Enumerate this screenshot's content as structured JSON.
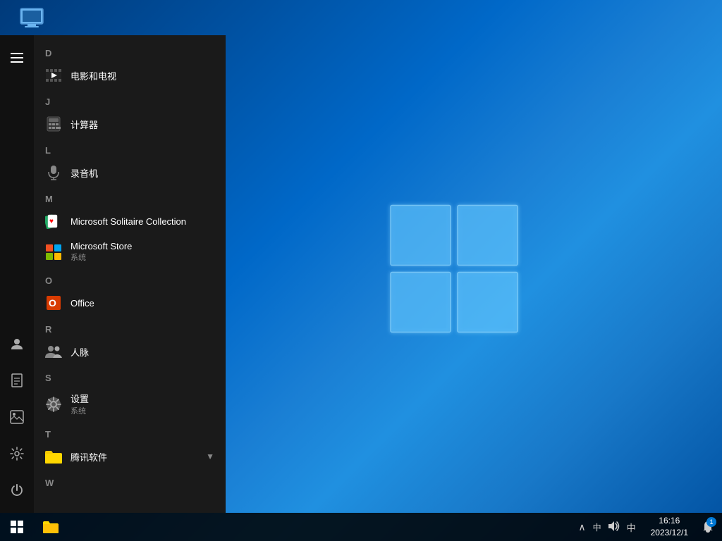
{
  "desktop": {
    "icon_label": "此电脑",
    "background_gradient": "windows10-blue"
  },
  "start_menu": {
    "sections": [
      {
        "letter": "D",
        "items": [
          {
            "id": "movies-tv",
            "name": "电影和电视",
            "icon": "film",
            "subtitle": ""
          }
        ]
      },
      {
        "letter": "J",
        "items": [
          {
            "id": "calculator",
            "name": "计算器",
            "icon": "calc",
            "subtitle": ""
          }
        ]
      },
      {
        "letter": "L",
        "items": [
          {
            "id": "recorder",
            "name": "录音机",
            "icon": "mic",
            "subtitle": ""
          }
        ]
      },
      {
        "letter": "M",
        "items": [
          {
            "id": "solitaire",
            "name": "Microsoft Solitaire Collection",
            "icon": "cards",
            "subtitle": ""
          },
          {
            "id": "store",
            "name": "Microsoft Store",
            "icon": "store",
            "subtitle": "系统"
          }
        ]
      },
      {
        "letter": "O",
        "items": [
          {
            "id": "office",
            "name": "Office",
            "icon": "office",
            "subtitle": ""
          }
        ]
      },
      {
        "letter": "R",
        "items": [
          {
            "id": "contacts",
            "name": "人脉",
            "icon": "people",
            "subtitle": ""
          }
        ]
      },
      {
        "letter": "S",
        "items": [
          {
            "id": "settings",
            "name": "设置",
            "icon": "settings",
            "subtitle": "系统"
          }
        ]
      },
      {
        "letter": "T",
        "items": []
      }
    ],
    "folders": [
      {
        "id": "tencent",
        "name": "腾讯软件",
        "icon": "folder",
        "expanded": false
      }
    ],
    "letter_W": "W"
  },
  "left_strip": {
    "icons": [
      {
        "id": "hamburger",
        "icon": "≡",
        "interactable": true
      },
      {
        "id": "user",
        "icon": "👤",
        "interactable": true
      },
      {
        "id": "document",
        "icon": "📄",
        "interactable": true
      },
      {
        "id": "photos",
        "icon": "🖼",
        "interactable": true
      },
      {
        "id": "settings",
        "icon": "⚙",
        "interactable": true
      },
      {
        "id": "power",
        "icon": "⏻",
        "interactable": true
      }
    ]
  },
  "taskbar": {
    "start_label": "⊞",
    "systray": {
      "arrow": "∧",
      "network": "中",
      "volume": "🔊",
      "ime": "中"
    },
    "clock": {
      "time": "16:16",
      "date": "2023/12/1"
    },
    "notification_count": "1"
  }
}
